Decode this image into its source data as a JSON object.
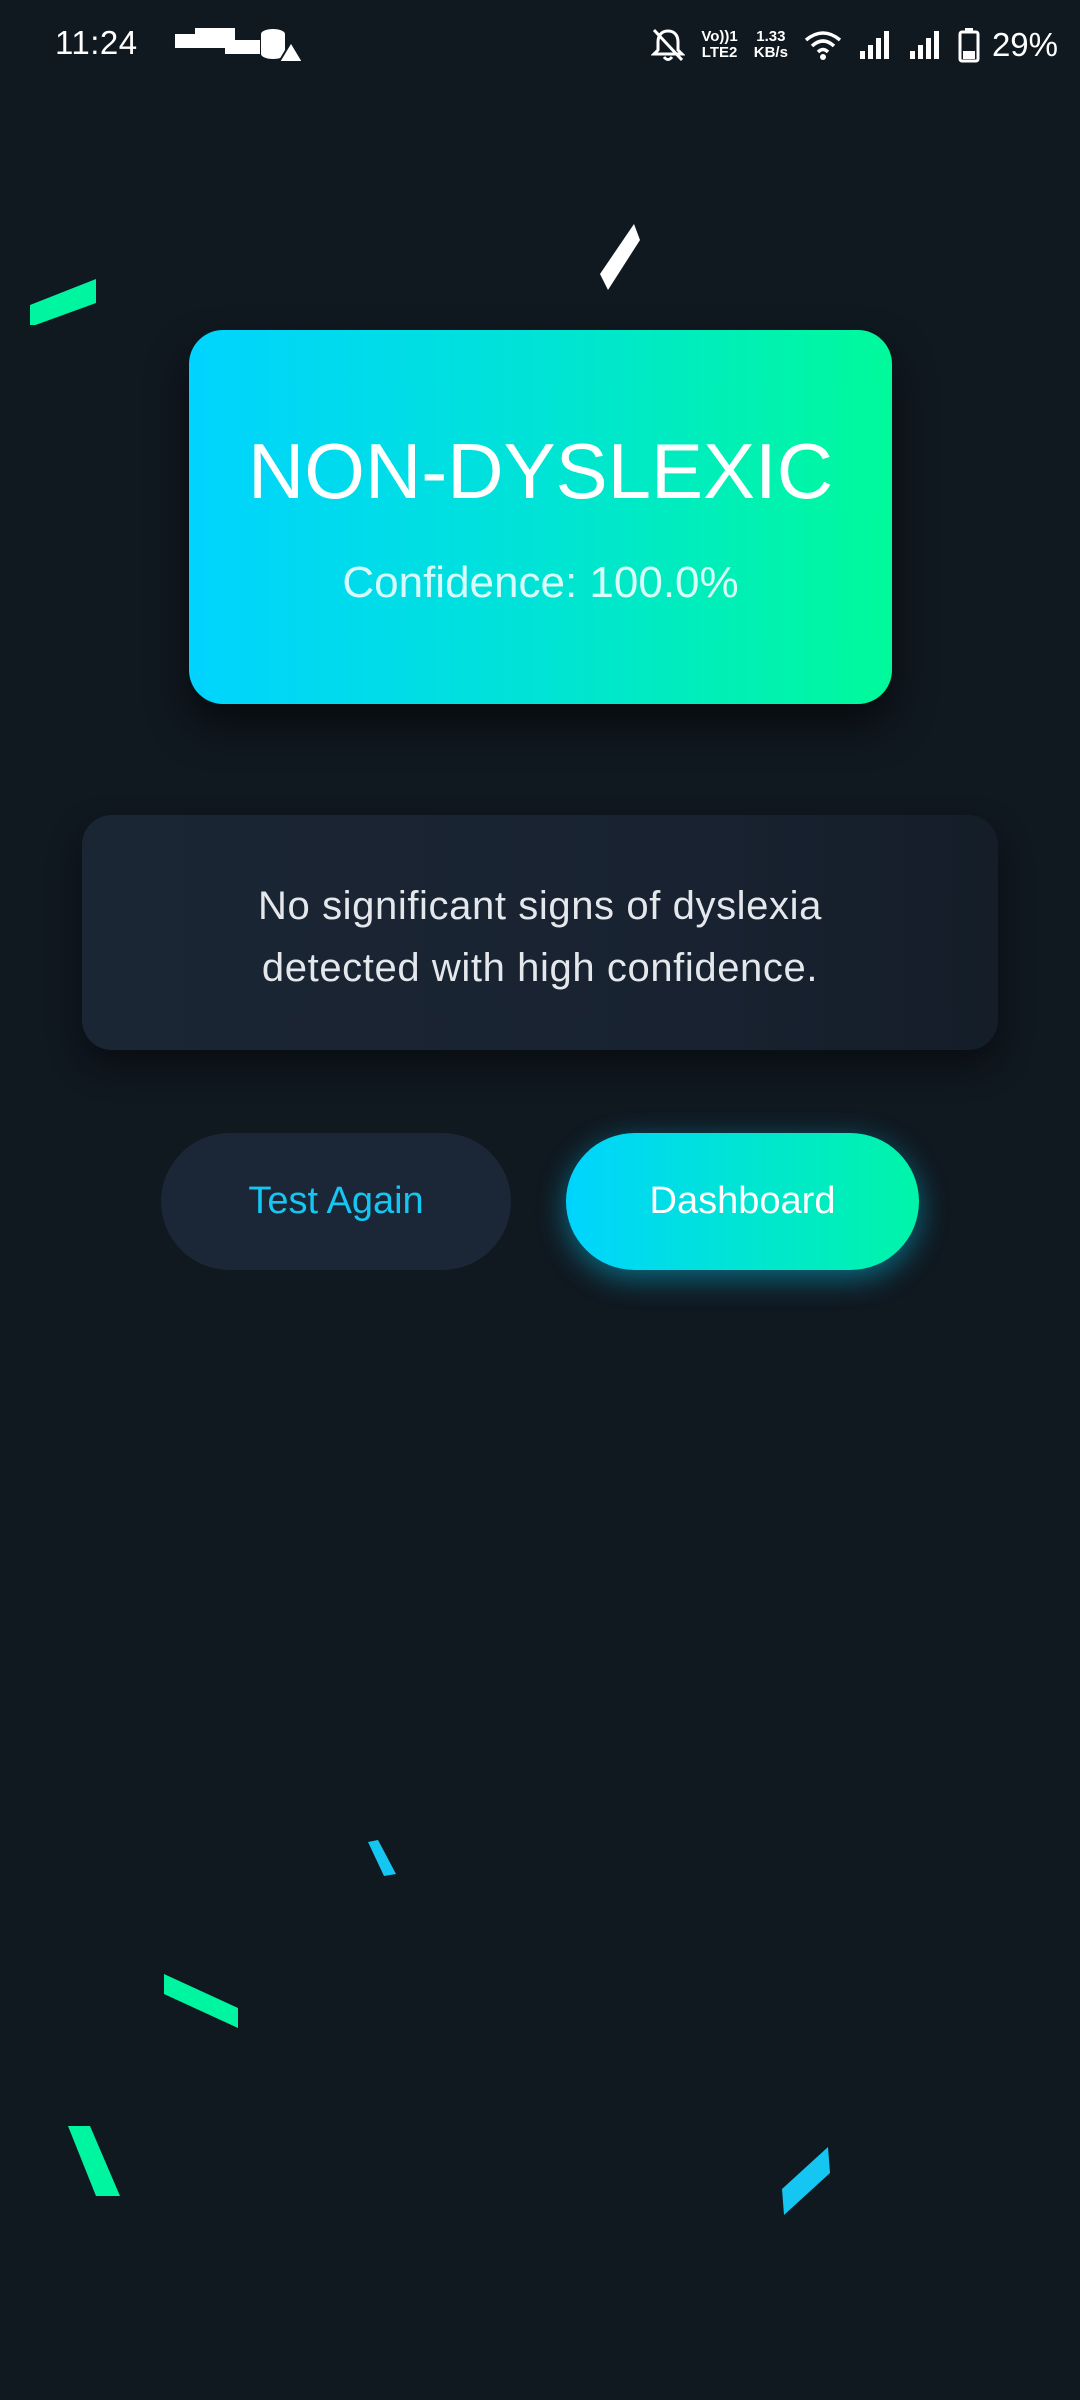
{
  "status_bar": {
    "time": "11:24",
    "net_lines": [
      "Vo))1",
      "LTE2"
    ],
    "speed_lines": [
      "1.33",
      "KB/s"
    ],
    "battery": "29%"
  },
  "result": {
    "label": "NON-DYSLEXIC",
    "confidence": "Confidence: 100.0%"
  },
  "message": {
    "line1": "No significant signs of dyslexia",
    "line2": "detected with high confidence."
  },
  "actions": {
    "test_again_label": "Test Again",
    "dashboard_label": "Dashboard"
  },
  "colors": {
    "background": "#101820",
    "accent_cyan": "#00d4ff",
    "accent_green": "#00fa9a",
    "card_dark": "#1b2635",
    "link_cyan": "#16c6f2"
  },
  "icons": [
    "mute-bell-icon",
    "wifi-icon",
    "signal-icon",
    "battery-icon",
    "notification-icons"
  ]
}
